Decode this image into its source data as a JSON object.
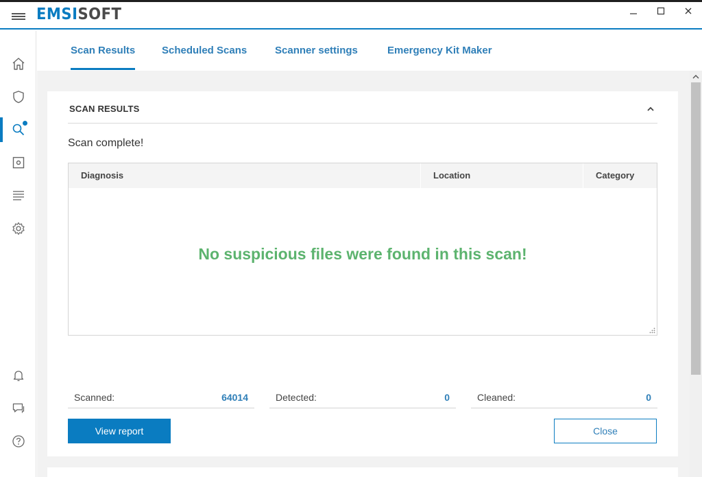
{
  "app": {
    "logo_part1": "EMSI",
    "logo_part2": "SOFT",
    "accent_color": "#0a7cc1",
    "success_color": "#5cb36e"
  },
  "window_controls": {
    "minimize_icon": "minimize-icon",
    "maximize_icon": "maximize-icon",
    "close_icon": "close-icon"
  },
  "sidebar": {
    "items": [
      {
        "id": "home",
        "icon": "home-icon",
        "active": false
      },
      {
        "id": "protection",
        "icon": "shield-icon",
        "active": false
      },
      {
        "id": "scan",
        "icon": "search-icon",
        "active": true,
        "notification_dot": true
      },
      {
        "id": "quarantine",
        "icon": "quarantine-icon",
        "active": false
      },
      {
        "id": "logs",
        "icon": "list-icon",
        "active": false
      },
      {
        "id": "settings",
        "icon": "gear-icon",
        "active": false
      }
    ],
    "bottom_items": [
      {
        "id": "notifications",
        "icon": "bell-icon"
      },
      {
        "id": "feedback",
        "icon": "chat-icon"
      },
      {
        "id": "help",
        "icon": "help-icon"
      }
    ]
  },
  "tabs": [
    {
      "label": "Scan Results",
      "active": true
    },
    {
      "label": "Scheduled Scans",
      "active": false
    },
    {
      "label": "Scanner settings",
      "active": false
    },
    {
      "label": "Emergency Kit Maker",
      "active": false
    }
  ],
  "results": {
    "title": "SCAN RESULTS",
    "status": "Scan complete!",
    "columns": [
      "Diagnosis",
      "Location",
      "Category"
    ],
    "empty_message": "No suspicious files were found in this scan!",
    "stats": [
      {
        "label": "Scanned:",
        "value": "64014"
      },
      {
        "label": "Detected:",
        "value": "0"
      },
      {
        "label": "Cleaned:",
        "value": "0"
      }
    ],
    "view_report_label": "View report",
    "close_label": "Close"
  }
}
